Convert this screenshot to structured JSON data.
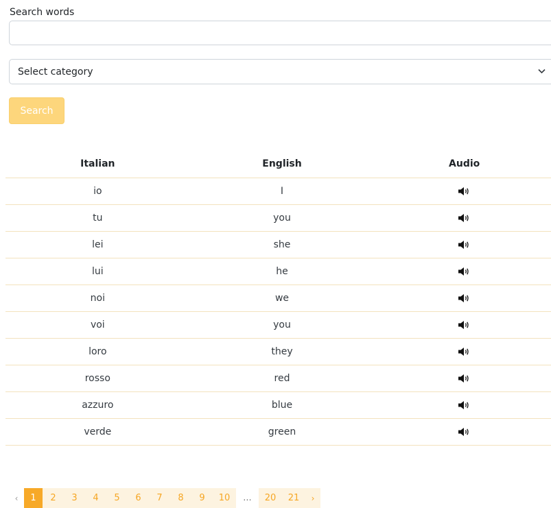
{
  "search": {
    "label": "Search words",
    "value": "",
    "placeholder": ""
  },
  "category": {
    "selected": "Select category"
  },
  "search_button": {
    "label": "Search"
  },
  "table": {
    "headers": [
      "Italian",
      "English",
      "Audio"
    ],
    "rows": [
      {
        "italian": "io",
        "english": "I"
      },
      {
        "italian": "tu",
        "english": "you"
      },
      {
        "italian": "lei",
        "english": "she"
      },
      {
        "italian": "lui",
        "english": "he"
      },
      {
        "italian": "noi",
        "english": "we"
      },
      {
        "italian": "voi",
        "english": "you"
      },
      {
        "italian": "loro",
        "english": "they"
      },
      {
        "italian": "rosso",
        "english": "red"
      },
      {
        "italian": "azzuro",
        "english": "blue"
      },
      {
        "italian": "verde",
        "english": "green"
      }
    ],
    "audio_icon": "speaker-icon"
  },
  "pagination": {
    "prev": "‹",
    "pages": [
      "1",
      "2",
      "3",
      "4",
      "5",
      "6",
      "7",
      "8",
      "9",
      "10"
    ],
    "ellipsis": "...",
    "last_pages": [
      "20",
      "21"
    ],
    "next": "›",
    "current": "1"
  },
  "colors": {
    "accent": "#f7a928",
    "button": "#fdd67c",
    "row_border": "#f3e2bd"
  }
}
